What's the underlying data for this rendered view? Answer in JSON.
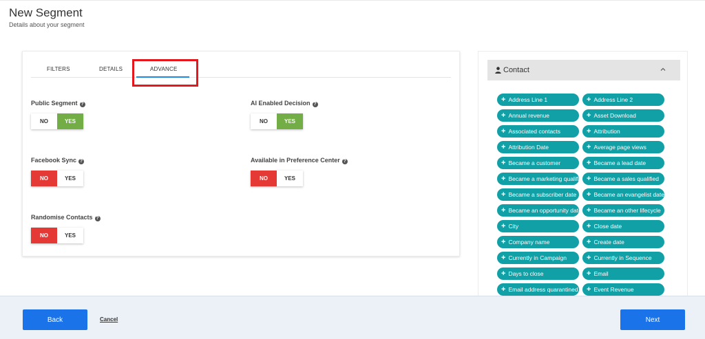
{
  "header": {
    "title": "New Segment",
    "subtitle": "Details about your segment"
  },
  "tabs": [
    {
      "label": "FILTERS",
      "active": false
    },
    {
      "label": "DETAILS",
      "active": false
    },
    {
      "label": "ADVANCE",
      "active": true
    }
  ],
  "settings": {
    "public_segment": {
      "label": "Public Segment",
      "selected": "YES"
    },
    "ai_enabled_decision": {
      "label": "AI Enabled Decision",
      "selected": "YES"
    },
    "facebook_sync": {
      "label": "Facebook Sync",
      "selected": "NO"
    },
    "preference_center": {
      "label": "Available in Preference Center",
      "selected": "NO"
    },
    "randomise_contacts": {
      "label": "Randomise Contacts",
      "selected": "NO"
    },
    "no_label": "NO",
    "yes_label": "YES"
  },
  "colors": {
    "yes_active": "#72ad46",
    "no_active": "#e53935",
    "chip": "#10a0a6",
    "primary_button": "#1a73e8",
    "highlight": "#e3171c"
  },
  "side_panel": {
    "title": "Contact",
    "fields": [
      "Address Line 1",
      "Address Line 2",
      "Annual revenue",
      "Asset Download",
      "Associated contacts",
      "Attribution",
      "Attribution Date",
      "Average page views",
      "Became a customer",
      "Became a lead date",
      "Became a marketing qualified",
      "Became a sales qualified",
      "Became a subscriber date",
      "Became an evangelist date",
      "Became an opportunity date",
      "Became an other lifecycle",
      "City",
      "Close date",
      "Company name",
      "Create date",
      "Currently in Campaign",
      "Currently in Sequence",
      "Days to close",
      "Email",
      "Email address quarantined",
      "Event Revenue"
    ]
  },
  "footer": {
    "back_label": "Back",
    "cancel_label": "Cancel",
    "next_label": "Next"
  }
}
